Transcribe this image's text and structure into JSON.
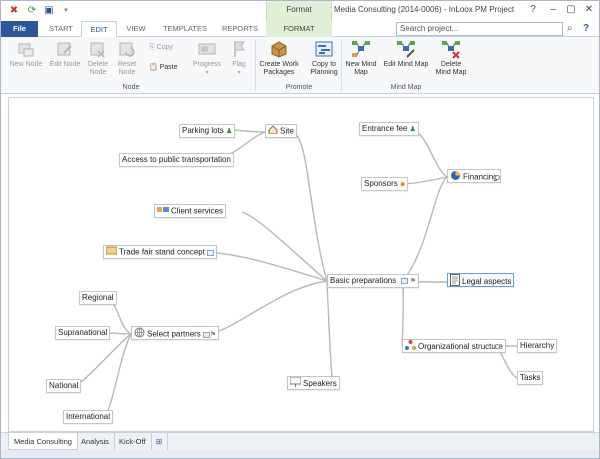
{
  "window": {
    "title": "Media Consulting (2014-0006) - InLoox PM Project",
    "context_tab": "Format",
    "controls": [
      "?",
      "–",
      "▢",
      "✕"
    ]
  },
  "tabs": [
    "File",
    "START",
    "EDIT",
    "VIEW",
    "TEMPLATES",
    "REPORTS",
    "FORMAT"
  ],
  "search": {
    "placeholder": "Search project..."
  },
  "ribbon": {
    "node_group": {
      "label": "Node",
      "buttons": [
        "New Node",
        "Edit Node",
        "Delete Node",
        "Reset Node"
      ],
      "copy": "Copy",
      "paste": "Paste",
      "progress": "Progress",
      "flag": "Flag"
    },
    "promote_group": {
      "label": "Promote",
      "buttons": [
        "Create Work Packages",
        "Copy to Planning"
      ]
    },
    "mindmap_group": {
      "label": "Mind Map",
      "buttons": [
        "New Mind Map",
        "Edit Mind Map",
        "Delete Mind Map"
      ]
    }
  },
  "mindmap": {
    "center": "Basic preparations",
    "nodes": {
      "site": "Site",
      "parking": "Parking lots",
      "access": "Access to public transportation",
      "client_services": "Client services",
      "trade_fair": "Trade fair stand concept",
      "select_partners": "Select partners",
      "regional": "Regional",
      "supranational": "Supranational",
      "national": "National",
      "international": "International",
      "speakers": "Speakers",
      "entrance_fee": "Entrance fee",
      "sponsors": "Sponsors",
      "financing": "Financing",
      "legal": "Legal aspects",
      "org": "Organizational structure",
      "hierarchy": "Hierarchy",
      "tasks": "Tasks"
    }
  },
  "bottom_tabs": [
    "Media Consulting",
    "Analysis",
    "Kick-Off"
  ]
}
